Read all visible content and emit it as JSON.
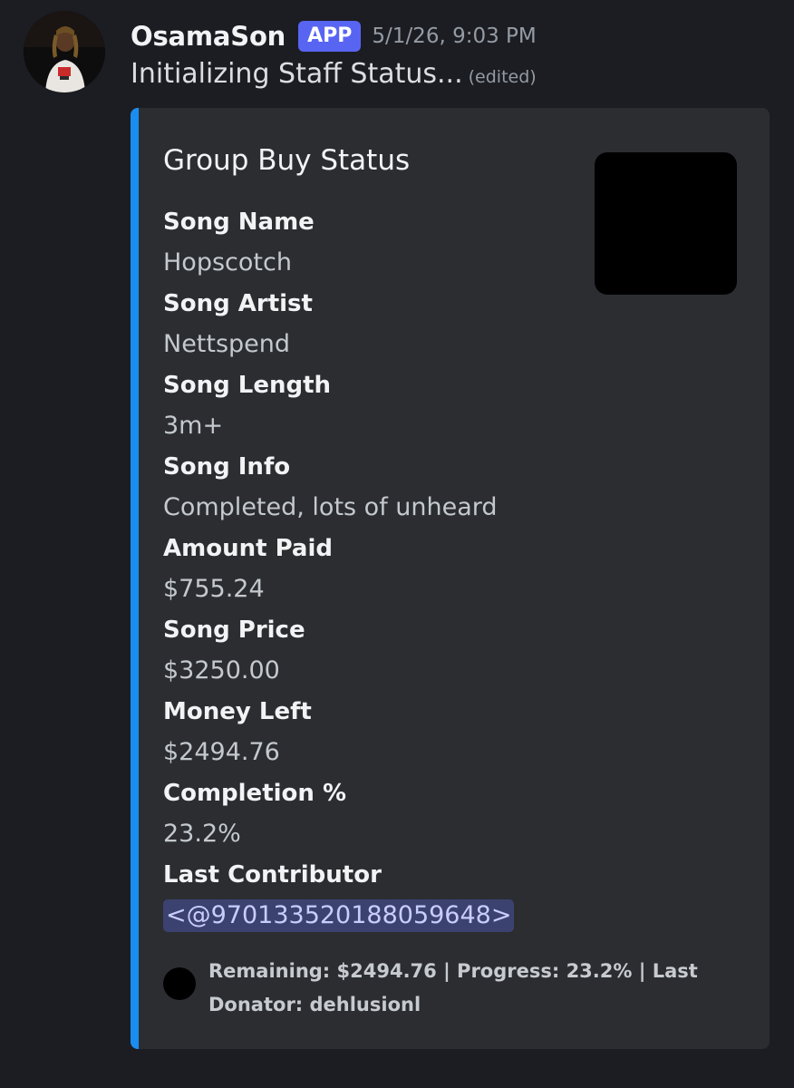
{
  "message": {
    "username": "OsamaSon",
    "badge": "APP",
    "timestamp": "5/1/26, 9:03 PM",
    "content": "Initializing Staff Status...",
    "edited_label": "(edited)"
  },
  "embed": {
    "accent_color": "#1a8df0",
    "title": "Group Buy Status",
    "fields": [
      {
        "name": "Song Name",
        "value": "Hopscotch"
      },
      {
        "name": "Song Artist",
        "value": "Nettspend"
      },
      {
        "name": "Song Length",
        "value": "3m+"
      },
      {
        "name": "Song Info",
        "value": "Completed, lots of unheard"
      },
      {
        "name": "Amount Paid",
        "value": "$755.24"
      },
      {
        "name": "Song Price",
        "value": "$3250.00"
      },
      {
        "name": "Money Left",
        "value": "$2494.76"
      },
      {
        "name": "Completion %",
        "value": "23.2%"
      },
      {
        "name": "Last Contributor",
        "value": "<@970133520188059648>"
      }
    ],
    "footer_text": "Remaining: $2494.76 | Progress: 23.2% | Last Donator: dehlusionl"
  },
  "icons": {
    "avatar": "user-avatar",
    "thumbnail": "embed-thumbnail",
    "footer": "footer-icon"
  }
}
